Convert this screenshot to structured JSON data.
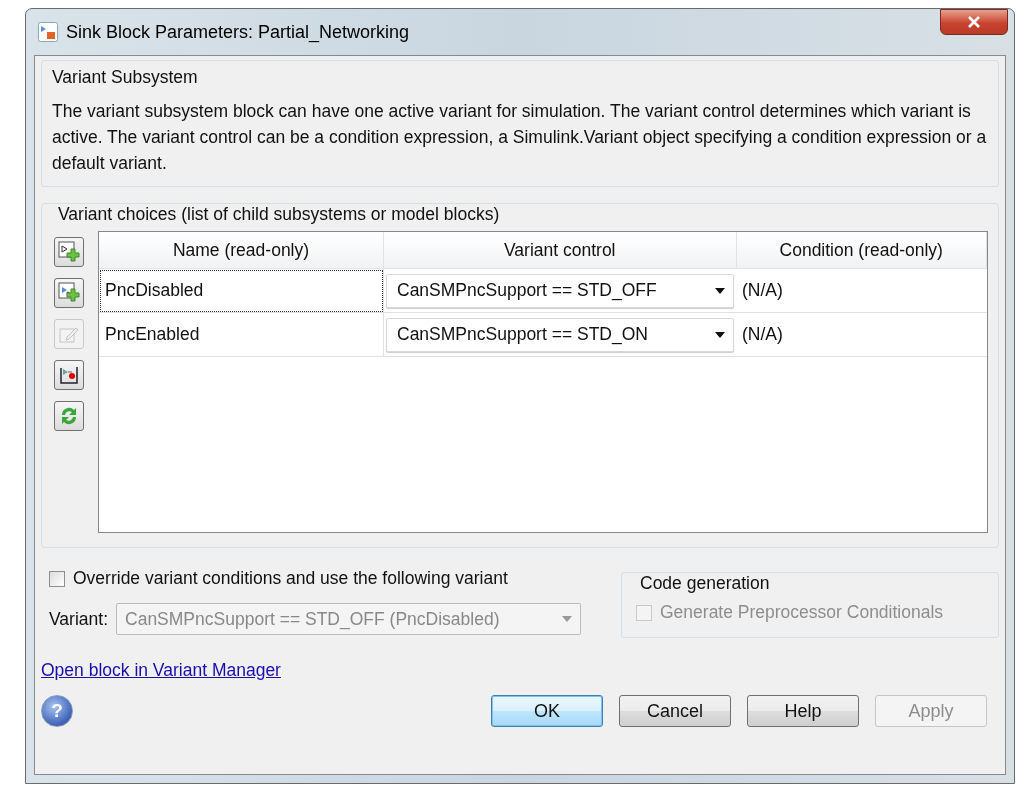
{
  "window": {
    "title": "Sink Block Parameters: Partial_Networking"
  },
  "description": {
    "title": "Variant Subsystem",
    "text": "The variant subsystem block can have one active variant for simulation. The variant control determines which variant is active. The variant control can be a condition expression, a Simulink.Variant object specifying a condition expression or a default variant."
  },
  "variant_choices": {
    "title": "Variant choices (list of child subsystems or model blocks)",
    "tools": [
      {
        "kind": "add-subsystem",
        "disabled": false
      },
      {
        "kind": "add-model",
        "disabled": false
      },
      {
        "kind": "edit",
        "disabled": true
      },
      {
        "kind": "open",
        "disabled": false
      },
      {
        "kind": "refresh",
        "disabled": false
      }
    ],
    "table": {
      "columns": [
        "Name (read-only)",
        "Variant control",
        "Condition (read-only)"
      ],
      "rows": [
        {
          "name": "PncDisabled",
          "control": "CanSMPncSupport == STD_OFF",
          "condition": "(N/A)",
          "focused": true
        },
        {
          "name": "PncEnabled",
          "control": "CanSMPncSupport == STD_ON",
          "condition": "(N/A)",
          "focused": false
        }
      ]
    }
  },
  "override": {
    "label": "Override variant conditions and use the following variant",
    "checked": false,
    "variant_label": "Variant:",
    "variant_value": "CanSMPncSupport == STD_OFF (PncDisabled)",
    "disabled": true
  },
  "code_generation": {
    "title": "Code generation",
    "label": "Generate Preprocessor Conditionals",
    "checked": false,
    "disabled": true
  },
  "link": "Open block in Variant Manager",
  "help_mark": "?",
  "buttons": [
    {
      "label": "OK",
      "default": true,
      "disabled": false
    },
    {
      "label": "Cancel",
      "default": false,
      "disabled": false
    },
    {
      "label": "Help",
      "default": false,
      "disabled": false
    },
    {
      "label": "Apply",
      "default": false,
      "disabled": true
    }
  ]
}
